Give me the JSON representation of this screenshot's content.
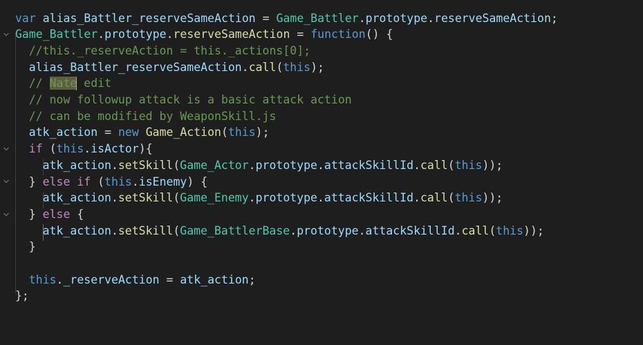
{
  "editor": {
    "lines": [
      {
        "tokens": [
          [
            "kw",
            "var"
          ],
          [
            "pl",
            " "
          ],
          [
            "var",
            "alias_Battler_reserveSameAction"
          ],
          [
            "pl",
            " = "
          ],
          [
            "cls",
            "Game_Battler"
          ],
          [
            "pl",
            "."
          ],
          [
            "var",
            "prototype"
          ],
          [
            "pl",
            "."
          ],
          [
            "var",
            "reserveSameAction"
          ],
          [
            "pl",
            ";"
          ]
        ]
      },
      {
        "tokens": [
          [
            "cls",
            "Game_Battler"
          ],
          [
            "pl",
            "."
          ],
          [
            "var",
            "prototype"
          ],
          [
            "pl",
            "."
          ],
          [
            "fn",
            "reserveSameAction"
          ],
          [
            "pl",
            " = "
          ],
          [
            "kw",
            "function"
          ],
          [
            "pl",
            "() {"
          ]
        ]
      },
      {
        "tokens": [
          [
            "cm",
            "//this._reserveAction = this._actions[0];"
          ]
        ]
      },
      {
        "tokens": [
          [
            "var",
            "alias_Battler_reserveSameAction"
          ],
          [
            "pl",
            "."
          ],
          [
            "fn",
            "call"
          ],
          [
            "pl",
            "("
          ],
          [
            "kw",
            "this"
          ],
          [
            "pl",
            ");"
          ]
        ]
      },
      {
        "tokens": [
          [
            "cm",
            "// "
          ],
          [
            "cmhl",
            "Nate"
          ],
          [
            "cursor",
            ""
          ],
          [
            "cm",
            " edit"
          ]
        ]
      },
      {
        "tokens": [
          [
            "cm",
            "// now followup attack is a basic attack action"
          ]
        ]
      },
      {
        "tokens": [
          [
            "cm",
            "// can be modified by WeaponSkill.js"
          ]
        ]
      },
      {
        "tokens": [
          [
            "var",
            "atk_action"
          ],
          [
            "pl",
            " = "
          ],
          [
            "kw",
            "new"
          ],
          [
            "pl",
            " "
          ],
          [
            "fn",
            "Game_Action"
          ],
          [
            "pl",
            "("
          ],
          [
            "kw",
            "this"
          ],
          [
            "pl",
            ");"
          ]
        ]
      },
      {
        "tokens": [
          [
            "ctl",
            "if"
          ],
          [
            "pl",
            " ("
          ],
          [
            "kw",
            "this"
          ],
          [
            "pl",
            "."
          ],
          [
            "var",
            "isActor"
          ],
          [
            "pl",
            "){"
          ]
        ]
      },
      {
        "tokens": [
          [
            "var",
            "atk_action"
          ],
          [
            "pl",
            "."
          ],
          [
            "fn",
            "setSkill"
          ],
          [
            "pl",
            "("
          ],
          [
            "cls",
            "Game_Actor"
          ],
          [
            "pl",
            "."
          ],
          [
            "var",
            "prototype"
          ],
          [
            "pl",
            "."
          ],
          [
            "var",
            "attackSkillId"
          ],
          [
            "pl",
            "."
          ],
          [
            "fn",
            "call"
          ],
          [
            "pl",
            "("
          ],
          [
            "kw",
            "this"
          ],
          [
            "pl",
            "));"
          ]
        ]
      },
      {
        "tokens": [
          [
            "pl",
            "} "
          ],
          [
            "ctl",
            "else"
          ],
          [
            "pl",
            " "
          ],
          [
            "ctl",
            "if"
          ],
          [
            "pl",
            " ("
          ],
          [
            "kw",
            "this"
          ],
          [
            "pl",
            "."
          ],
          [
            "var",
            "isEnemy"
          ],
          [
            "pl",
            ") {"
          ]
        ]
      },
      {
        "tokens": [
          [
            "var",
            "atk_action"
          ],
          [
            "pl",
            "."
          ],
          [
            "fn",
            "setSkill"
          ],
          [
            "pl",
            "("
          ],
          [
            "cls",
            "Game_Enemy"
          ],
          [
            "pl",
            "."
          ],
          [
            "var",
            "prototype"
          ],
          [
            "pl",
            "."
          ],
          [
            "var",
            "attackSkillId"
          ],
          [
            "pl",
            "."
          ],
          [
            "fn",
            "call"
          ],
          [
            "pl",
            "("
          ],
          [
            "kw",
            "this"
          ],
          [
            "pl",
            "));"
          ]
        ]
      },
      {
        "tokens": [
          [
            "pl",
            "} "
          ],
          [
            "ctl",
            "else"
          ],
          [
            "pl",
            " {"
          ]
        ]
      },
      {
        "tokens": [
          [
            "var",
            "atk_action"
          ],
          [
            "pl",
            "."
          ],
          [
            "fn",
            "setSkill"
          ],
          [
            "pl",
            "("
          ],
          [
            "cls",
            "Game_BattlerBase"
          ],
          [
            "pl",
            "."
          ],
          [
            "var",
            "prototype"
          ],
          [
            "pl",
            "."
          ],
          [
            "var",
            "attackSkillId"
          ],
          [
            "pl",
            "."
          ],
          [
            "fn",
            "call"
          ],
          [
            "pl",
            "("
          ],
          [
            "kw",
            "this"
          ],
          [
            "pl",
            "));"
          ]
        ]
      },
      {
        "tokens": [
          [
            "pl",
            "}"
          ]
        ]
      },
      {
        "tokens": []
      },
      {
        "tokens": [
          [
            "kw",
            "this"
          ],
          [
            "pl",
            "."
          ],
          [
            "var",
            "_reserveAction"
          ],
          [
            "pl",
            " = "
          ],
          [
            "var",
            "atk_action"
          ],
          [
            "pl",
            ";"
          ]
        ]
      },
      {
        "tokens": [
          [
            "pl",
            "};"
          ]
        ]
      }
    ],
    "fold_icon": "chevron-down-icon"
  }
}
